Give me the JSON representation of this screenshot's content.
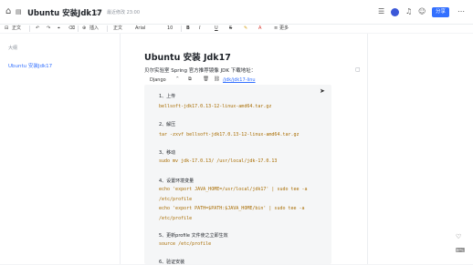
{
  "header": {
    "title": "Ubuntu 安装Jdk17",
    "saved_status": "最近修改 23:00",
    "share_label": "分享",
    "icons": [
      "home-icon",
      "sidebar-toggle-icon",
      "star-icon",
      "share-link-icon",
      "menu-icon",
      "bell-icon",
      "user-add-icon",
      "more-icon"
    ]
  },
  "toolbar": {
    "body_label": "正文",
    "insert_label": "插入",
    "font_label": "Arial",
    "size_label": "10",
    "more_label": "更多",
    "undo": "↶",
    "redo": "↷",
    "bold": "B",
    "italic": "I",
    "underline": "U",
    "strike": "S"
  },
  "outline": {
    "title": "大纲",
    "items": [
      "Ubuntu 安装Jdk17"
    ]
  },
  "document": {
    "h1": "Ubuntu  安装  Jdk17",
    "intro": "贝尔实验室 Spring 官方推荐镜像 JDK 下载地址：",
    "code_lang": "Django",
    "code_link": "/jdk/jdk17-linu",
    "code_lines": [
      {
        "type": "comment",
        "text": "1、上传"
      },
      {
        "type": "code",
        "text": "bellsoft-jdk17.0.13-12-linux-amd64.tar.gz"
      },
      {
        "type": "comment",
        "text": "2、解压"
      },
      {
        "type": "code",
        "text": "tar -zxvf bellsoft-jdk17.0.13-12-linux-amd64.tar.gz"
      },
      {
        "type": "comment",
        "text": "3、移动"
      },
      {
        "type": "code",
        "text": "sudo mv jdk-17.0.13/ /usr/local/jdk-17.0.13"
      },
      {
        "type": "comment",
        "text": "4、设置环境变量"
      },
      {
        "type": "code",
        "text": "echo 'export JAVA_HOME=/usr/local/jdk17' | sudo tee -a"
      },
      {
        "type": "code",
        "text": "/etc/profile"
      },
      {
        "type": "code",
        "text": "echo 'export PATH=$PATH:$JAVA_HOME/bin' | sudo tee -a"
      },
      {
        "type": "code",
        "text": "/etc/profile"
      },
      {
        "type": "comment",
        "text": "5、更新profile 文件使之立即生效"
      },
      {
        "type": "code",
        "text": "source /etc/profile"
      },
      {
        "type": "comment",
        "text": "6、验证安装"
      }
    ]
  }
}
